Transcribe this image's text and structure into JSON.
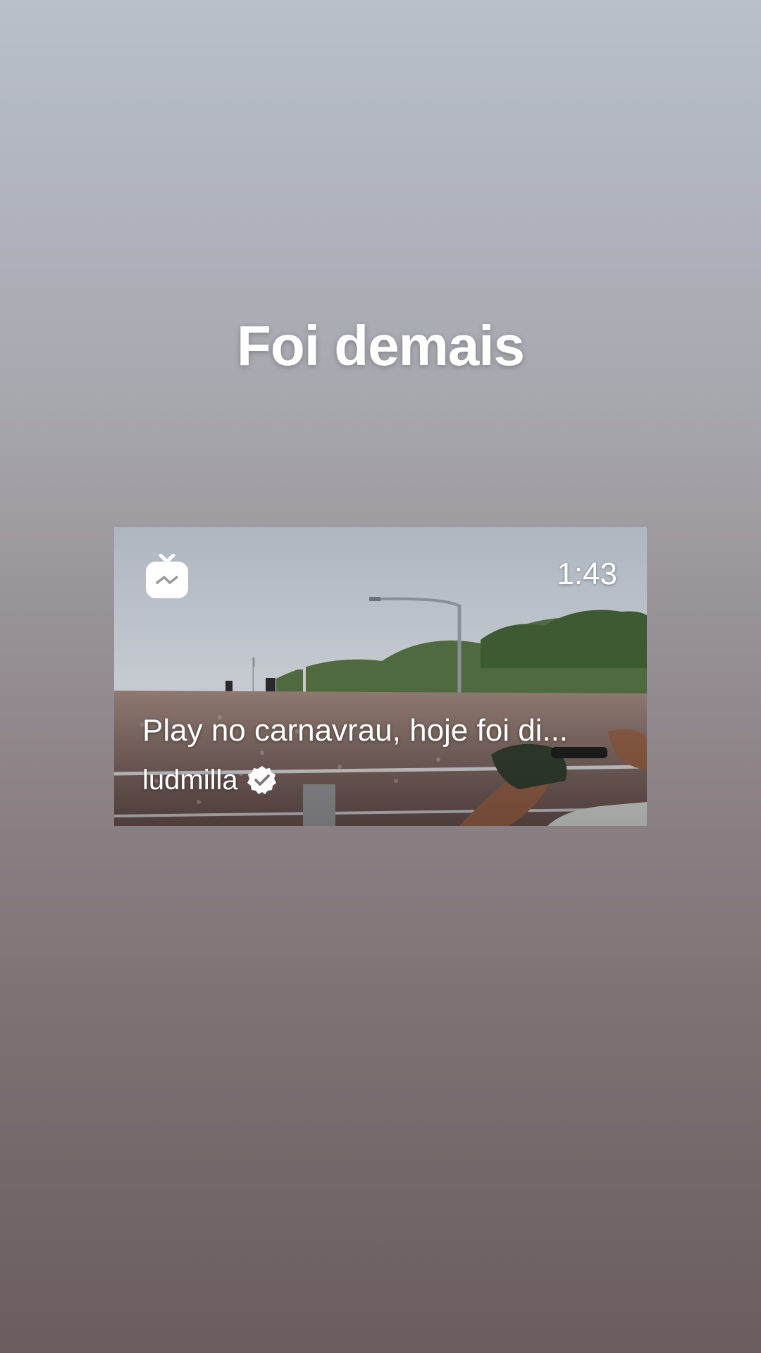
{
  "story": {
    "caption": "Foi demais"
  },
  "igtv_share": {
    "logo_icon": "igtv-logo-icon",
    "duration": "1:43",
    "title": "Play no carnavrau, hoje foi di...",
    "author": "ludmilla",
    "verified_icon": "verified-badge-icon"
  },
  "colors": {
    "background_top": "#b9c0ca",
    "background_bottom": "#6b5d5d",
    "text": "#ffffff"
  }
}
